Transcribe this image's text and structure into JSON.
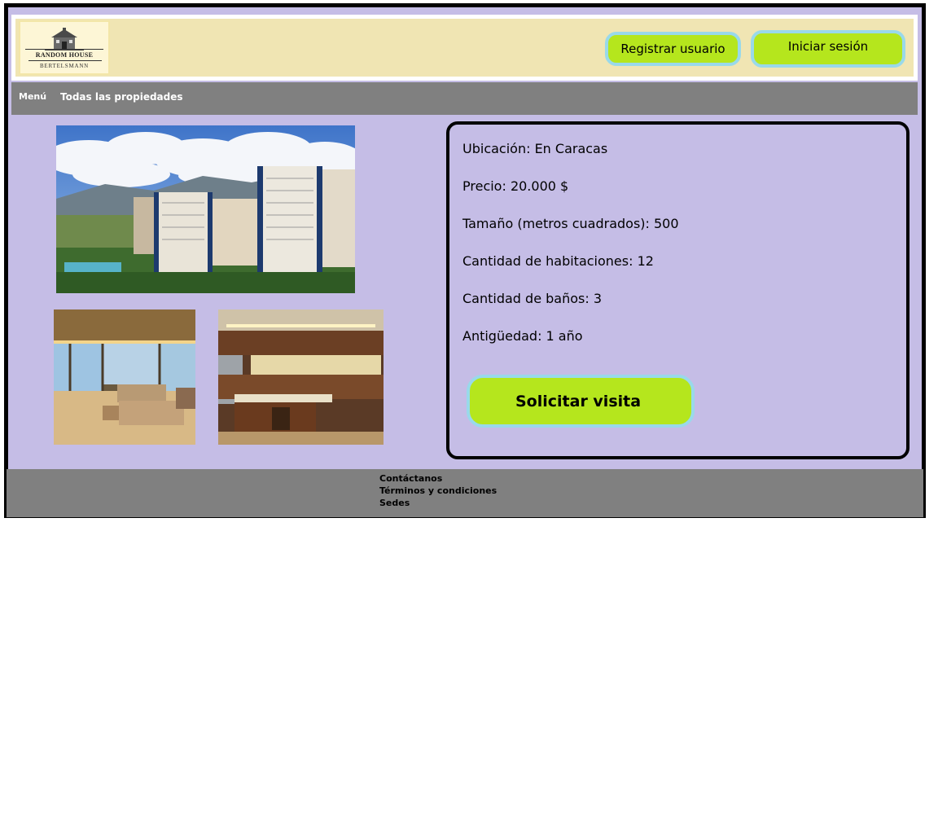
{
  "header": {
    "logo": {
      "line1": "RANDOM HOUSE",
      "line2": "BERTELSMANN",
      "icon": "house-logo-icon"
    },
    "register_label": "Registrar usuario",
    "login_label": "Iniciar sesión"
  },
  "nav": {
    "menu_label": "Menú",
    "all_properties_label": "Todas las propiedades"
  },
  "property": {
    "photos": [
      "building-exterior-photo",
      "living-room-photo",
      "kitchen-photo"
    ],
    "location": "Ubicación: En Caracas",
    "price": "Precio: 20.000 $",
    "size": "Tamaño (metros cuadrados): 500",
    "rooms": "Cantidad de habitaciones: 12",
    "baths": "Cantidad de baños: 3",
    "age": "Antigüedad: 1 año",
    "visit_label": "Solicitar visita"
  },
  "footer": {
    "links": [
      "Contáctanos",
      "Términos y condiciones",
      "Sedes"
    ]
  },
  "colors": {
    "page_bg": "#c5bde6",
    "header_bg": "#f0e5b3",
    "bar_bg": "#808080",
    "button_fill": "#b5e61d",
    "button_border": "#99d9ea"
  }
}
